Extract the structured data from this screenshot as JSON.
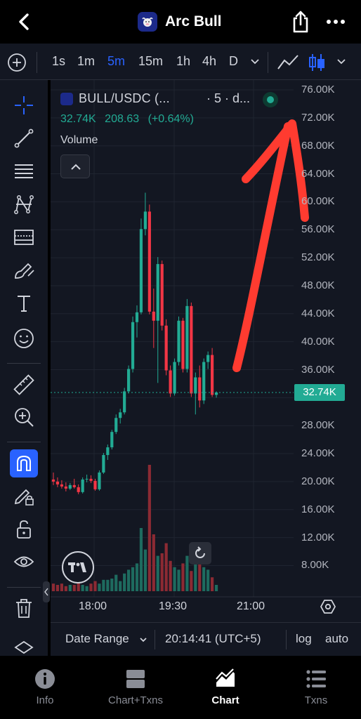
{
  "header": {
    "title": "Arc Bull",
    "icons": {
      "back": "chevron-left-icon",
      "share": "share-icon",
      "more": "ellipsis-icon"
    }
  },
  "toolbar": {
    "intervals": [
      "1s",
      "1m",
      "5m",
      "15m",
      "1h",
      "4h",
      "D"
    ],
    "active_interval": "5m"
  },
  "sidebar": {
    "tools": [
      "crosshair",
      "trend-line",
      "fib-retracement",
      "pattern",
      "prediction",
      "brush",
      "text",
      "emoji",
      "ruler",
      "zoom-in",
      "magnet",
      "lock-drawings",
      "lock",
      "eye",
      "trash"
    ],
    "active_tool": "magnet"
  },
  "legend": {
    "symbol": "BULL/USDC (...",
    "meta": "· 5 · d...",
    "last": "32.74K",
    "change": "208.63",
    "change_pct": "(+0.64%)",
    "volume_label": "Volume"
  },
  "price_axis": [
    "76.00K",
    "72.00K",
    "68.00K",
    "64.00K",
    "60.00K",
    "56.00K",
    "52.00K",
    "48.00K",
    "44.00K",
    "40.00K",
    "36.00K",
    "32.00K",
    "28.00K",
    "24.00K",
    "20.00K",
    "16.00K",
    "12.00K",
    "8.00K"
  ],
  "current_price": "32.74K",
  "time_axis": [
    "18:00",
    "19:30",
    "21:00"
  ],
  "range_bar": {
    "date_range": "Date Range",
    "clock": "20:14:41 (UTC+5)",
    "log": "log",
    "auto": "auto"
  },
  "tabs": [
    {
      "label": "Info",
      "icon": "info-icon"
    },
    {
      "label": "Chart+Txns",
      "icon": "split-view-icon"
    },
    {
      "label": "Chart",
      "icon": "chart-icon",
      "active": true
    },
    {
      "label": "Txns",
      "icon": "list-icon"
    }
  ],
  "colors": {
    "up": "#22ab94",
    "down": "#f23645",
    "accent": "#2962ff",
    "annotation": "#ff3b30"
  },
  "chart_data": {
    "type": "candlestick",
    "title": "",
    "price_unit": "K",
    "y_range": [
      6,
      78
    ],
    "candles": [
      {
        "o": 20.3,
        "h": 21.3,
        "l": 19.5,
        "c": 20.0
      },
      {
        "o": 20.0,
        "h": 20.6,
        "l": 19.2,
        "c": 19.6
      },
      {
        "o": 19.6,
        "h": 20.2,
        "l": 19.0,
        "c": 19.3
      },
      {
        "o": 19.3,
        "h": 19.9,
        "l": 18.6,
        "c": 19.0
      },
      {
        "o": 19.0,
        "h": 19.8,
        "l": 18.8,
        "c": 19.5
      },
      {
        "o": 19.5,
        "h": 20.4,
        "l": 19.0,
        "c": 19.2
      },
      {
        "o": 19.2,
        "h": 19.6,
        "l": 18.2,
        "c": 18.5
      },
      {
        "o": 18.5,
        "h": 20.6,
        "l": 18.3,
        "c": 20.3
      },
      {
        "o": 20.3,
        "h": 21.0,
        "l": 19.9,
        "c": 20.4
      },
      {
        "o": 20.4,
        "h": 20.9,
        "l": 19.8,
        "c": 20.1
      },
      {
        "o": 20.1,
        "h": 20.4,
        "l": 18.7,
        "c": 18.9
      },
      {
        "o": 18.9,
        "h": 21.6,
        "l": 18.7,
        "c": 21.3
      },
      {
        "o": 21.3,
        "h": 24.1,
        "l": 21.1,
        "c": 23.8
      },
      {
        "o": 23.8,
        "h": 25.3,
        "l": 23.1,
        "c": 24.9
      },
      {
        "o": 24.9,
        "h": 27.4,
        "l": 24.6,
        "c": 27.1
      },
      {
        "o": 27.1,
        "h": 29.6,
        "l": 26.8,
        "c": 29.1
      },
      {
        "o": 29.1,
        "h": 30.4,
        "l": 28.3,
        "c": 29.9
      },
      {
        "o": 29.9,
        "h": 33.4,
        "l": 29.6,
        "c": 32.9
      },
      {
        "o": 32.9,
        "h": 36.6,
        "l": 32.6,
        "c": 36.1
      },
      {
        "o": 36.1,
        "h": 43.6,
        "l": 35.6,
        "c": 42.8
      },
      {
        "o": 42.8,
        "h": 45.2,
        "l": 40.6,
        "c": 44.2
      },
      {
        "o": 44.2,
        "h": 57.6,
        "l": 43.9,
        "c": 56.1
      },
      {
        "o": 56.1,
        "h": 61.3,
        "l": 55.2,
        "c": 58.6
      },
      {
        "o": 58.6,
        "h": 59.6,
        "l": 43.9,
        "c": 44.3
      },
      {
        "o": 44.3,
        "h": 47.6,
        "l": 39.1,
        "c": 43.0
      },
      {
        "o": 43.0,
        "h": 52.1,
        "l": 34.1,
        "c": 51.1
      },
      {
        "o": 51.1,
        "h": 51.6,
        "l": 41.6,
        "c": 42.3
      },
      {
        "o": 42.3,
        "h": 43.2,
        "l": 35.2,
        "c": 35.9
      },
      {
        "o": 35.9,
        "h": 36.6,
        "l": 32.1,
        "c": 32.6
      },
      {
        "o": 32.6,
        "h": 37.6,
        "l": 32.3,
        "c": 37.1
      },
      {
        "o": 37.1,
        "h": 43.6,
        "l": 36.6,
        "c": 43.0
      },
      {
        "o": 43.0,
        "h": 43.4,
        "l": 35.6,
        "c": 36.1
      },
      {
        "o": 36.1,
        "h": 46.1,
        "l": 35.6,
        "c": 45.1
      },
      {
        "o": 45.1,
        "h": 45.6,
        "l": 32.1,
        "c": 32.6
      },
      {
        "o": 32.6,
        "h": 35.6,
        "l": 29.6,
        "c": 34.9
      },
      {
        "o": 34.9,
        "h": 36.6,
        "l": 30.6,
        "c": 31.6
      },
      {
        "o": 31.6,
        "h": 37.6,
        "l": 31.1,
        "c": 37.1
      },
      {
        "o": 37.1,
        "h": 38.6,
        "l": 36.1,
        "c": 38.1
      },
      {
        "o": 38.1,
        "h": 39.1,
        "l": 32.1,
        "c": 32.4
      },
      {
        "o": 32.4,
        "h": 32.9,
        "l": 32.0,
        "c": 32.74
      }
    ],
    "volume": [
      0.6,
      0.5,
      0.6,
      0.4,
      0.5,
      0.5,
      0.7,
      0.5,
      0.4,
      0.6,
      0.8,
      0.6,
      0.9,
      0.9,
      1.0,
      1.3,
      0.8,
      1.4,
      1.7,
      1.9,
      2.2,
      5.0,
      3.3,
      10.0,
      4.5,
      2.8,
      3.0,
      3.8,
      2.4,
      1.9,
      1.7,
      2.2,
      2.8,
      1.6,
      2.4,
      2.9,
      1.9,
      1.7,
      1.1,
      0.5
    ]
  }
}
